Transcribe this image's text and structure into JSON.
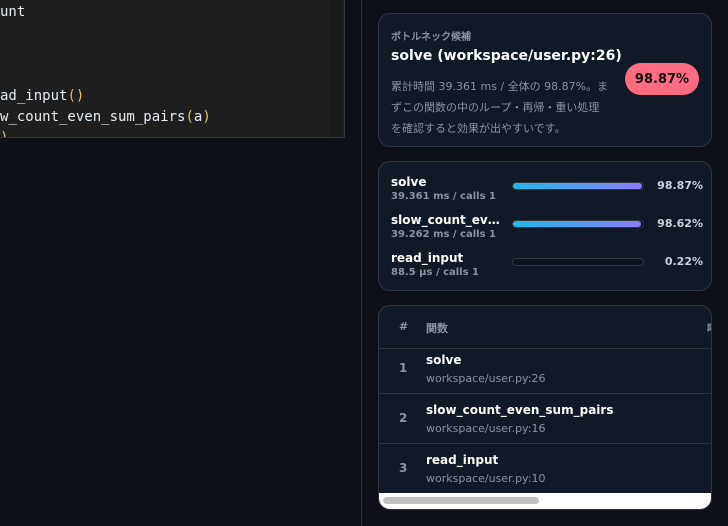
{
  "editor": {
    "lines": [
      "unt",
      "ad_input",
      "w_count_even_sum_pairs",
      "a"
    ]
  },
  "hotspot": {
    "kicker": "ボトルネック候補",
    "title": "solve (workspace/user.py:26)",
    "detail": "累計時間 39.361 ms / 全体の 98.87%。まずこの関数の中のループ・再帰・重い処理を確認すると効果が出やすいです。",
    "badge": "98.87%"
  },
  "bars": [
    {
      "name": "solve",
      "meta": "39.361 ms / calls 1",
      "percent_label": "98.87%",
      "fraction": 0.9887
    },
    {
      "name": "slow_count_even_sum_pairs",
      "meta": "39.262 ms / calls 1",
      "percent_label": "98.62%",
      "fraction": 0.9862
    },
    {
      "name": "read_input",
      "meta": "88.5 µs / calls 1",
      "percent_label": "0.22%",
      "fraction": 0.0022
    }
  ],
  "table": {
    "headers": [
      "#",
      "関数",
      "呼"
    ],
    "rows": [
      {
        "num": "1",
        "func": "solve",
        "file": "workspace/user.py:26"
      },
      {
        "num": "2",
        "func": "slow_count_even_sum_pairs",
        "file": "workspace/user.py:16"
      },
      {
        "num": "3",
        "func": "read_input",
        "file": "workspace/user.py:10"
      }
    ]
  }
}
